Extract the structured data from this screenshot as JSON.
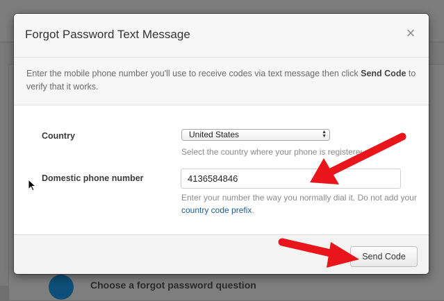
{
  "background": {
    "section_heading": "Choose a forgot password question"
  },
  "modal": {
    "title": "Forgot Password Text Message",
    "close_glyph": "×",
    "intro_before": "Enter the mobile phone number you'll use to receive codes via text message then click ",
    "intro_bold": "Send Code",
    "intro_after": " to verify that it works.",
    "country": {
      "label": "Country",
      "selected": "United States",
      "help": "Select the country where your phone is registered."
    },
    "phone": {
      "label": "Domestic phone number",
      "value": "4136584846",
      "help_before": "Enter your number the way you normally dial it. Do not add your ",
      "help_link": "country code prefix",
      "help_after": "."
    },
    "send_button_label": "Send Code"
  },
  "colors": {
    "annotation_arrow": "#e8151b",
    "link": "#1f5a8a",
    "background_icon": "#0d4f78"
  },
  "icons": {
    "close": "close-icon",
    "select_arrows": "select-updown-icon",
    "pointer": "mouse-pointer-icon",
    "background": "badge-icon"
  }
}
